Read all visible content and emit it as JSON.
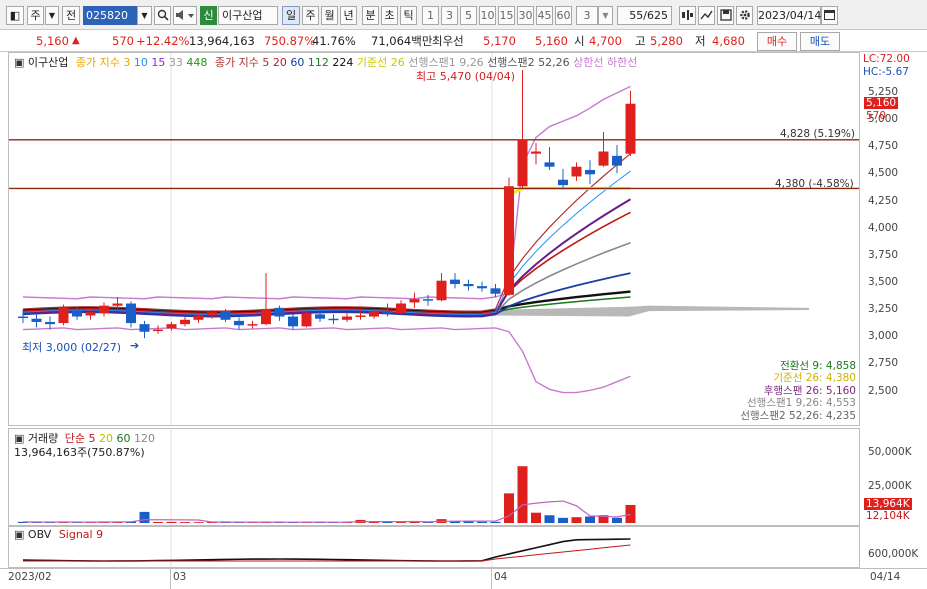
{
  "toolbar": {
    "mode_label": "주",
    "prefix_label": "전",
    "stock_code": "025820",
    "new_badge": "신",
    "stock_name": "이구산업",
    "periods": [
      "일",
      "주",
      "월",
      "년",
      "분",
      "초",
      "틱"
    ],
    "selected_period": "일",
    "intervals": [
      "1",
      "3",
      "5",
      "10",
      "15",
      "30",
      "45",
      "60"
    ],
    "count_value": "3",
    "page_counter": "55/625",
    "date_value": "2023/04/14"
  },
  "quote": {
    "price": "5,160",
    "change": "570",
    "change_pct": "+12.42%",
    "volume": "13,964,163",
    "volume_ratio": "750.87%",
    "turnover_pct": "41.76%",
    "amount": "71,064백만",
    "best_label": "최우선",
    "best_ask": "5,170",
    "best_bid": "5,160",
    "open_label": "시",
    "open": "4,700",
    "high_label": "고",
    "high": "5,280",
    "low_label": "저",
    "low": "4,680",
    "buy_label": "매수",
    "sell_label": "매도"
  },
  "price_panel": {
    "legend_name": "이구산업",
    "ma_price_label": "종가 지수",
    "ma_price_periods": [
      "3",
      "10",
      "15",
      "33",
      "448"
    ],
    "ma_close_label": "종가 지수",
    "ma_close_periods": [
      "5",
      "20",
      "60",
      "112",
      "224"
    ],
    "ichimoku_labels": [
      "기준선 26",
      "선행스팬1 9,26",
      "선행스팬2 52,26",
      "상한선",
      "하한선"
    ],
    "high_annotation": "최고 5,470 (04/04)",
    "low_annotation": "최저 3,000 (02/27)",
    "lc_label": "LC:72.00",
    "hc_label": "HC:-5.67",
    "line_upper_label": "4,828 (5.19%)",
    "line_lower_label": "4,380 (-4.58%)",
    "current_price_tag": "5,160",
    "change_tag": "570",
    "indicator_values": [
      {
        "label": "전환선 9: 4,858",
        "color": "#1a7a1a"
      },
      {
        "label": "기준선 26: 4,380",
        "color": "#c8b400"
      },
      {
        "label": "후행스팬 26: 5,160",
        "color": "#7a2a7a"
      },
      {
        "label": "선행스팬1 9,26: 4,553",
        "color": "#888888"
      },
      {
        "label": "선행스팬2 52,26: 4,235",
        "color": "#666666"
      }
    ]
  },
  "volume_panel": {
    "title": "거래량",
    "ma_label": "단순",
    "ma_periods": [
      "5",
      "20",
      "60",
      "120"
    ],
    "summary": "13,964,163주(750.87%)",
    "current_tag": "13,964K",
    "secondary_tag": "12,104K"
  },
  "obv_panel": {
    "title": "OBV",
    "signal_label": "Signal 9"
  },
  "x_axis": {
    "date_start": "2023/02",
    "month_03": "03",
    "month_04": "04",
    "date_end": "04/14"
  },
  "chart_data": {
    "type": "candlestick",
    "y_axis_ticks": [
      "5,250",
      "5,000",
      "4,750",
      "4,500",
      "4,250",
      "4,000",
      "3,750",
      "3,500",
      "3,250",
      "3,000",
      "2,750",
      "2,500"
    ],
    "y_axis_range": [
      2400,
      5500
    ],
    "volume_ticks": [
      "50,000K",
      "25,000K"
    ],
    "obv_ticks": [
      "600,000K"
    ],
    "horizontal_lines": [
      4828,
      4380
    ],
    "highest": {
      "value": 5470,
      "date": "04/04"
    },
    "lowest": {
      "value": 3000,
      "date": "02/27"
    },
    "candles": [
      {
        "o": 3200,
        "h": 3260,
        "l": 3140,
        "c": 3190
      },
      {
        "o": 3180,
        "h": 3230,
        "l": 3100,
        "c": 3150
      },
      {
        "o": 3150,
        "h": 3200,
        "l": 3080,
        "c": 3130
      },
      {
        "o": 3140,
        "h": 3310,
        "l": 3120,
        "c": 3280
      },
      {
        "o": 3250,
        "h": 3290,
        "l": 3170,
        "c": 3200
      },
      {
        "o": 3210,
        "h": 3260,
        "l": 3170,
        "c": 3240
      },
      {
        "o": 3230,
        "h": 3330,
        "l": 3200,
        "c": 3300
      },
      {
        "o": 3300,
        "h": 3380,
        "l": 3250,
        "c": 3320
      },
      {
        "o": 3320,
        "h": 3340,
        "l": 3100,
        "c": 3140
      },
      {
        "o": 3130,
        "h": 3160,
        "l": 3000,
        "c": 3060
      },
      {
        "o": 3070,
        "h": 3120,
        "l": 3040,
        "c": 3080
      },
      {
        "o": 3090,
        "h": 3150,
        "l": 3070,
        "c": 3130
      },
      {
        "o": 3130,
        "h": 3200,
        "l": 3110,
        "c": 3170
      },
      {
        "o": 3170,
        "h": 3230,
        "l": 3140,
        "c": 3210
      },
      {
        "o": 3210,
        "h": 3260,
        "l": 3180,
        "c": 3240
      },
      {
        "o": 3250,
        "h": 3270,
        "l": 3150,
        "c": 3170
      },
      {
        "o": 3160,
        "h": 3190,
        "l": 3080,
        "c": 3120
      },
      {
        "o": 3120,
        "h": 3160,
        "l": 3090,
        "c": 3130
      },
      {
        "o": 3130,
        "h": 3600,
        "l": 3120,
        "c": 3270
      },
      {
        "o": 3280,
        "h": 3300,
        "l": 3160,
        "c": 3200
      },
      {
        "o": 3200,
        "h": 3220,
        "l": 3080,
        "c": 3110
      },
      {
        "o": 3110,
        "h": 3250,
        "l": 3100,
        "c": 3230
      },
      {
        "o": 3220,
        "h": 3260,
        "l": 3150,
        "c": 3180
      },
      {
        "o": 3180,
        "h": 3220,
        "l": 3130,
        "c": 3170
      },
      {
        "o": 3170,
        "h": 3240,
        "l": 3150,
        "c": 3200
      },
      {
        "o": 3200,
        "h": 3260,
        "l": 3170,
        "c": 3210
      },
      {
        "o": 3200,
        "h": 3270,
        "l": 3180,
        "c": 3250
      },
      {
        "o": 3250,
        "h": 3320,
        "l": 3200,
        "c": 3230
      },
      {
        "o": 3230,
        "h": 3350,
        "l": 3220,
        "c": 3320
      },
      {
        "o": 3330,
        "h": 3420,
        "l": 3280,
        "c": 3360
      },
      {
        "o": 3360,
        "h": 3400,
        "l": 3300,
        "c": 3350
      },
      {
        "o": 3350,
        "h": 3600,
        "l": 3340,
        "c": 3530
      },
      {
        "o": 3540,
        "h": 3600,
        "l": 3460,
        "c": 3500
      },
      {
        "o": 3500,
        "h": 3540,
        "l": 3440,
        "c": 3480
      },
      {
        "o": 3480,
        "h": 3520,
        "l": 3430,
        "c": 3460
      },
      {
        "o": 3460,
        "h": 3500,
        "l": 3380,
        "c": 3410
      },
      {
        "o": 3400,
        "h": 4480,
        "l": 3390,
        "c": 4400
      },
      {
        "o": 4400,
        "h": 5470,
        "l": 4380,
        "c": 4830
      },
      {
        "o": 4700,
        "h": 4800,
        "l": 4600,
        "c": 4720
      },
      {
        "o": 4620,
        "h": 4760,
        "l": 4550,
        "c": 4580
      },
      {
        "o": 4460,
        "h": 4560,
        "l": 4370,
        "c": 4410
      },
      {
        "o": 4490,
        "h": 4620,
        "l": 4450,
        "c": 4580
      },
      {
        "o": 4550,
        "h": 4640,
        "l": 4420,
        "c": 4510
      },
      {
        "o": 4590,
        "h": 4900,
        "l": 4580,
        "c": 4720
      },
      {
        "o": 4680,
        "h": 4780,
        "l": 4520,
        "c": 4590
      },
      {
        "o": 4700,
        "h": 5280,
        "l": 4680,
        "c": 5160
      }
    ],
    "volumes_k": [
      900,
      700,
      600,
      800,
      650,
      700,
      1100,
      900,
      1200,
      8600,
      800,
      900,
      700,
      600,
      750,
      800,
      650,
      600,
      700,
      650,
      600,
      700,
      650,
      600,
      800,
      2400,
      900,
      800,
      700,
      1000,
      900,
      3000,
      1400,
      1200,
      1000,
      900,
      23000,
      44000,
      8000,
      6000,
      4000,
      4500,
      5000,
      6000,
      4000,
      13964
    ]
  }
}
